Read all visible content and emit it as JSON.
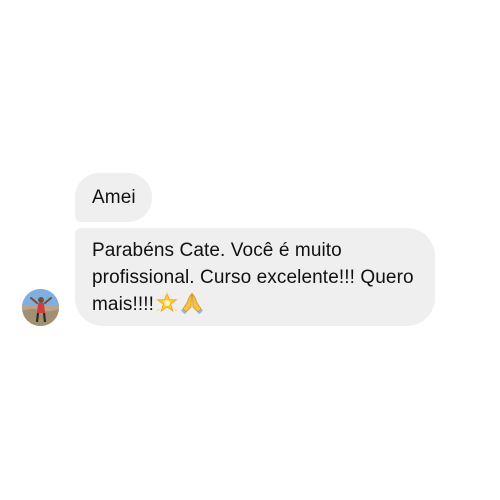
{
  "conversation": {
    "messages": [
      {
        "text": "Amei"
      },
      {
        "text": "Parabéns Cate. Você é muito profissional. Curso excelente!!! Quero mais!!!!",
        "emojis": [
          "glowing-star-emoji",
          "folded-hands-emoji"
        ]
      }
    ],
    "sender": {
      "avatar_icon": "user-avatar-photo"
    }
  }
}
